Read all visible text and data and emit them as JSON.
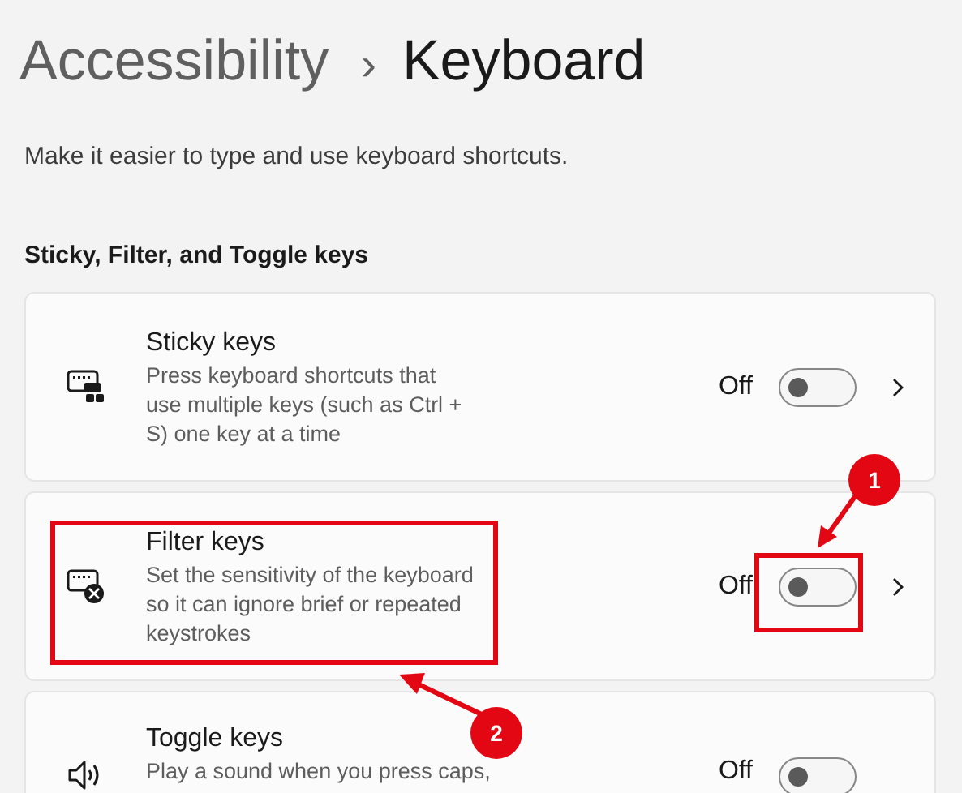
{
  "breadcrumb": {
    "parent": "Accessibility",
    "separator": "›",
    "current": "Keyboard"
  },
  "subtitle": "Make it easier to type and use keyboard shortcuts.",
  "section": {
    "heading": "Sticky, Filter, and Toggle keys",
    "items": [
      {
        "title": "Sticky keys",
        "description": "Press keyboard shortcuts that use multiple keys (such as Ctrl + S) one key at a time",
        "state_label": "Off",
        "on": false
      },
      {
        "title": "Filter keys",
        "description": "Set the sensitivity of the keyboard so it can ignore brief or repeated keystrokes",
        "state_label": "Off",
        "on": false
      },
      {
        "title": "Toggle keys",
        "description": "Play a sound when you press caps,",
        "state_label": "Off",
        "on": false
      }
    ]
  },
  "annotations": [
    {
      "label": "1"
    },
    {
      "label": "2"
    }
  ]
}
